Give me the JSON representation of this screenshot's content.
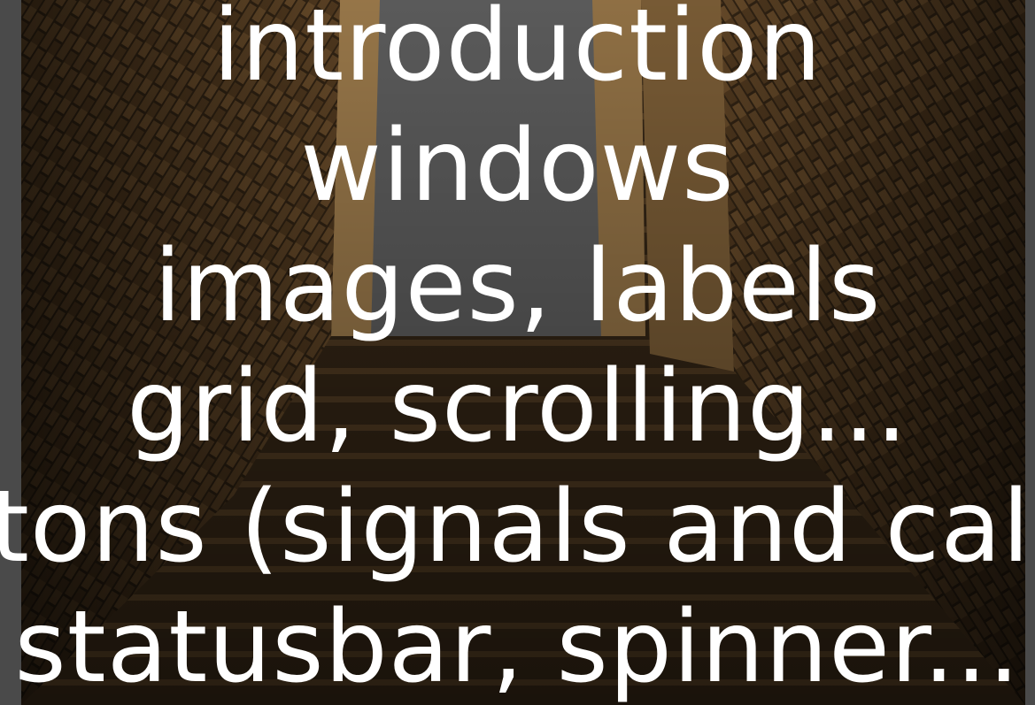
{
  "slide": {
    "lines": [
      "introduction",
      "windows",
      "images, labels",
      "grid, scrolling...",
      "buttons (signals and callbacks)",
      "statusbar, spinner..."
    ]
  },
  "colors": {
    "text": "#ffffff",
    "frame_background": "#4a4a4a",
    "brick_wall": "#6b4a26",
    "sky_gap": "#6a6a6a"
  },
  "icons": {
    "background": "photo-stairway-between-brick-walls"
  }
}
